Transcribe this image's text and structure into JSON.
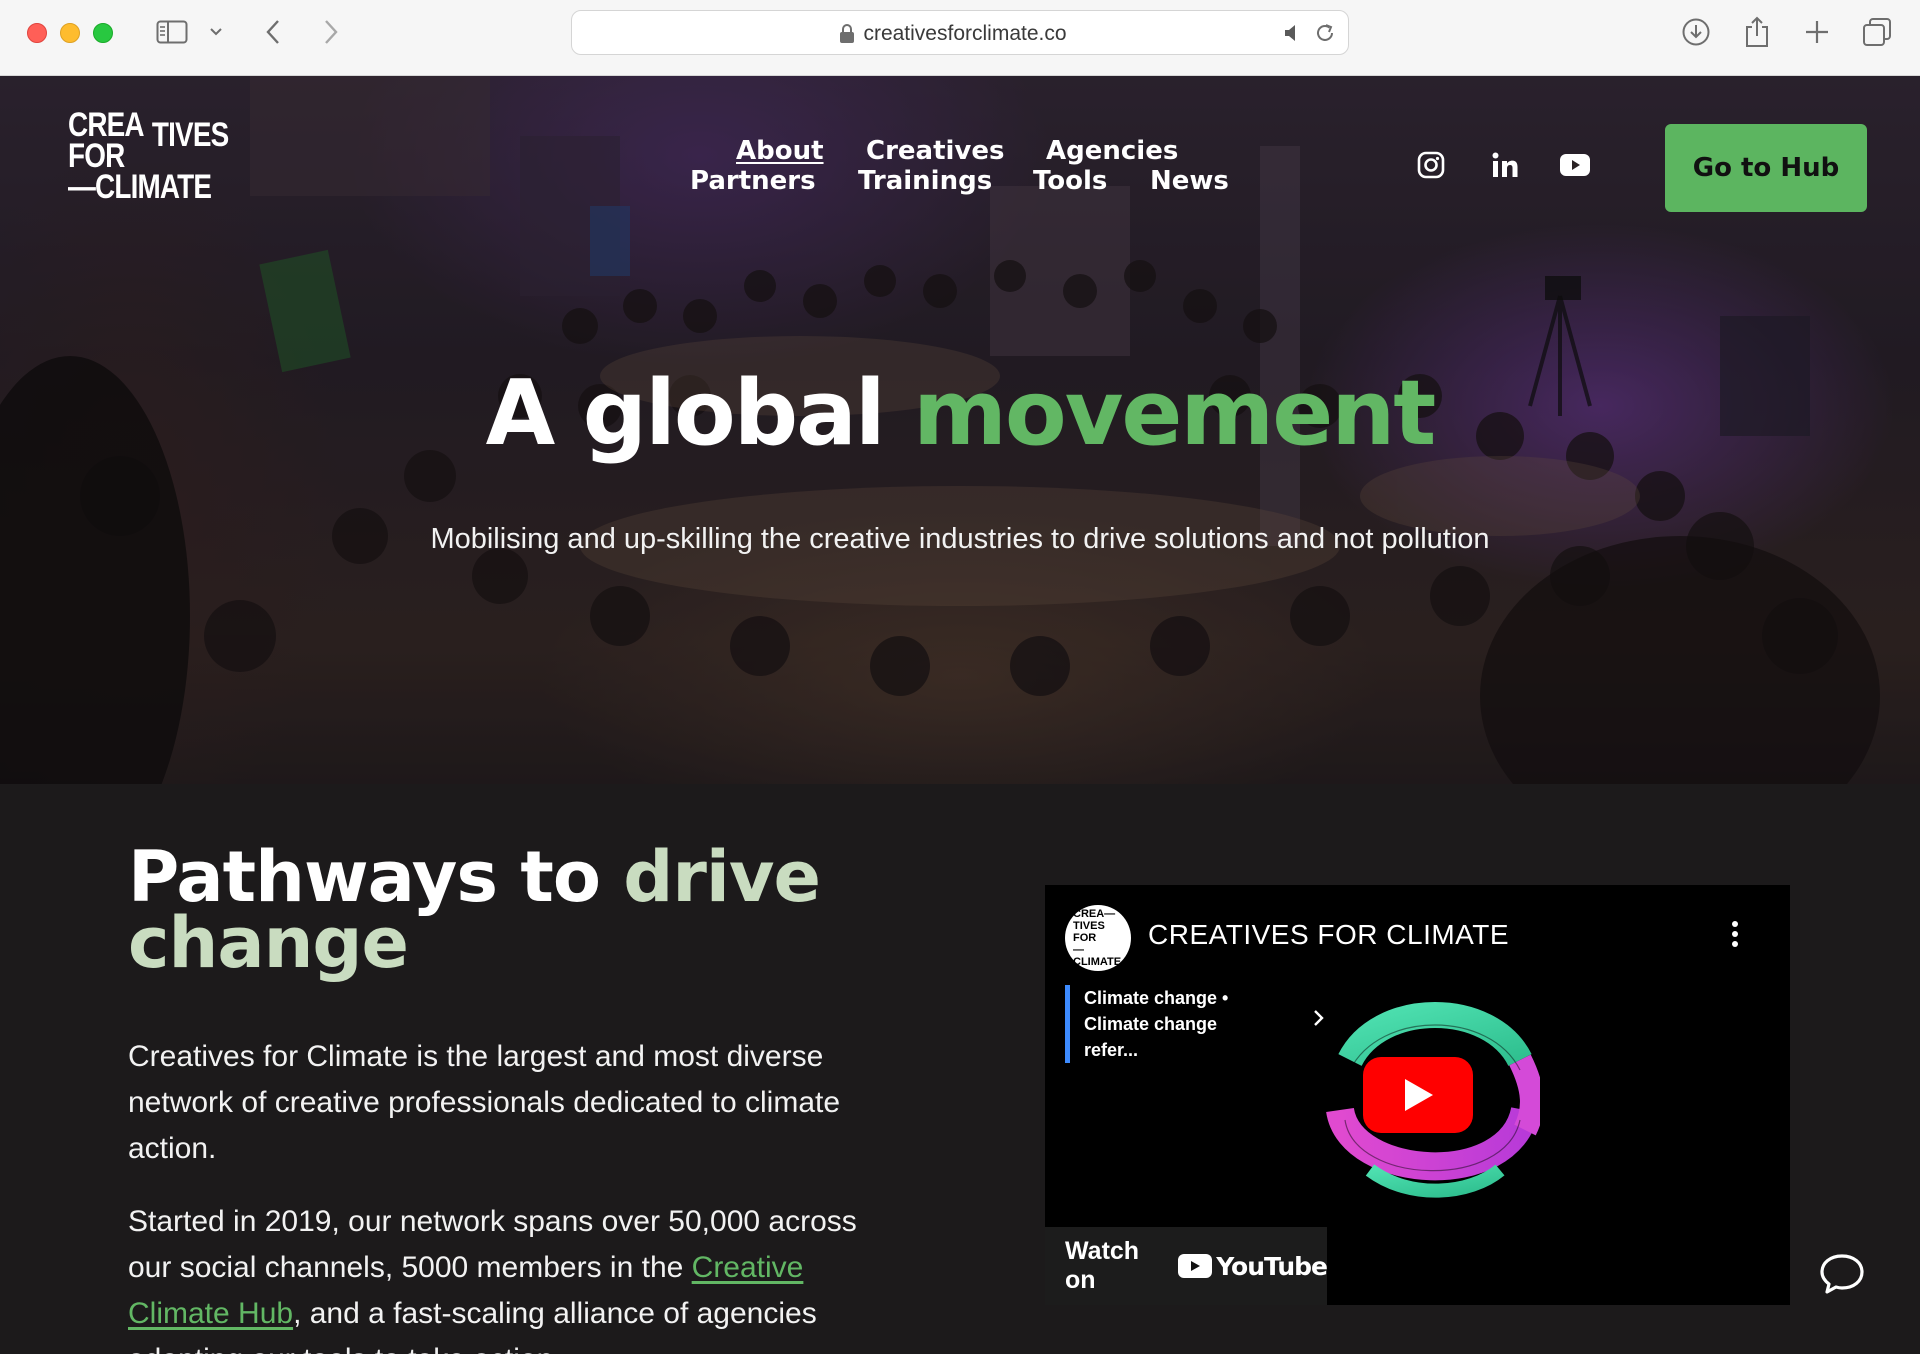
{
  "browser": {
    "url": "creativesforclimate.co"
  },
  "logo": {
    "line1": "CREA—TIVES",
    "line2": "FOR—",
    "line3": "—CLIMATE",
    "part_crea": "CREA",
    "part_tives": "TIVES",
    "part_for": "FOR",
    "part_climate": "—CLIMATE"
  },
  "nav": {
    "about": "About",
    "creatives": "Creatives",
    "agencies": "Agencies",
    "partners": "Partners",
    "trainings": "Trainings",
    "tools": "Tools",
    "news": "News"
  },
  "header": {
    "hub_button": "Go to Hub"
  },
  "hero": {
    "title_part1": "A global ",
    "title_accent": "movement",
    "subtitle": "Mobilising and up-skilling the creative industries to drive solutions and not pollution"
  },
  "main": {
    "heading_part1": "Pathways to ",
    "heading_accent": "drive change",
    "para1": "Creatives for Climate is the largest and most diverse network of creative professionals dedicated to climate action.",
    "para2_before": "Started in 2019, our network spans over 50,000 across our social channels, 5000 members in the ",
    "para2_link": "Creative Climate Hub",
    "para2_after": ", and a fast-scaling alliance of agencies adopting our tools to take action."
  },
  "video": {
    "channel_name": "CREATIVES FOR CLIMATE",
    "card_line1": "Climate change •",
    "card_line2": "Climate change refer...",
    "watch_on": "Watch on",
    "youtube": "YouTube",
    "avatar_l1": "CREA—TIVES",
    "avatar_l2": "FOR",
    "avatar_l3": "—CLIMATE"
  },
  "colors": {
    "accent_green": "#62b764",
    "button_green": "#5cb560",
    "heading_accent": "#c9dcc0",
    "background": "#1c1a1b"
  }
}
